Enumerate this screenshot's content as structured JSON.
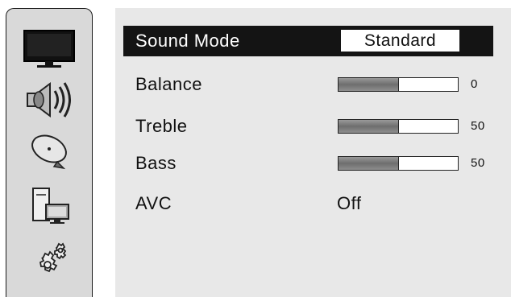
{
  "sidebar": {
    "items": [
      {
        "icon": "tv-icon"
      },
      {
        "icon": "speaker-icon"
      },
      {
        "icon": "satellite-dish-icon"
      },
      {
        "icon": "computer-icon"
      },
      {
        "icon": "gears-icon"
      }
    ]
  },
  "menu": {
    "sound_mode": {
      "label": "Sound Mode",
      "value": "Standard"
    },
    "balance": {
      "label": "Balance",
      "value": "0",
      "level": 0.5
    },
    "treble": {
      "label": "Treble",
      "value": "50",
      "level": 0.5
    },
    "bass": {
      "label": "Bass",
      "value": "50",
      "level": 0.5
    },
    "avc": {
      "label": "AVC",
      "value": "Off"
    }
  },
  "colors": {
    "selected_bg": "#141414",
    "panel_bg": "#e8e8e8",
    "sidebar_bg": "#d9d9d9"
  }
}
